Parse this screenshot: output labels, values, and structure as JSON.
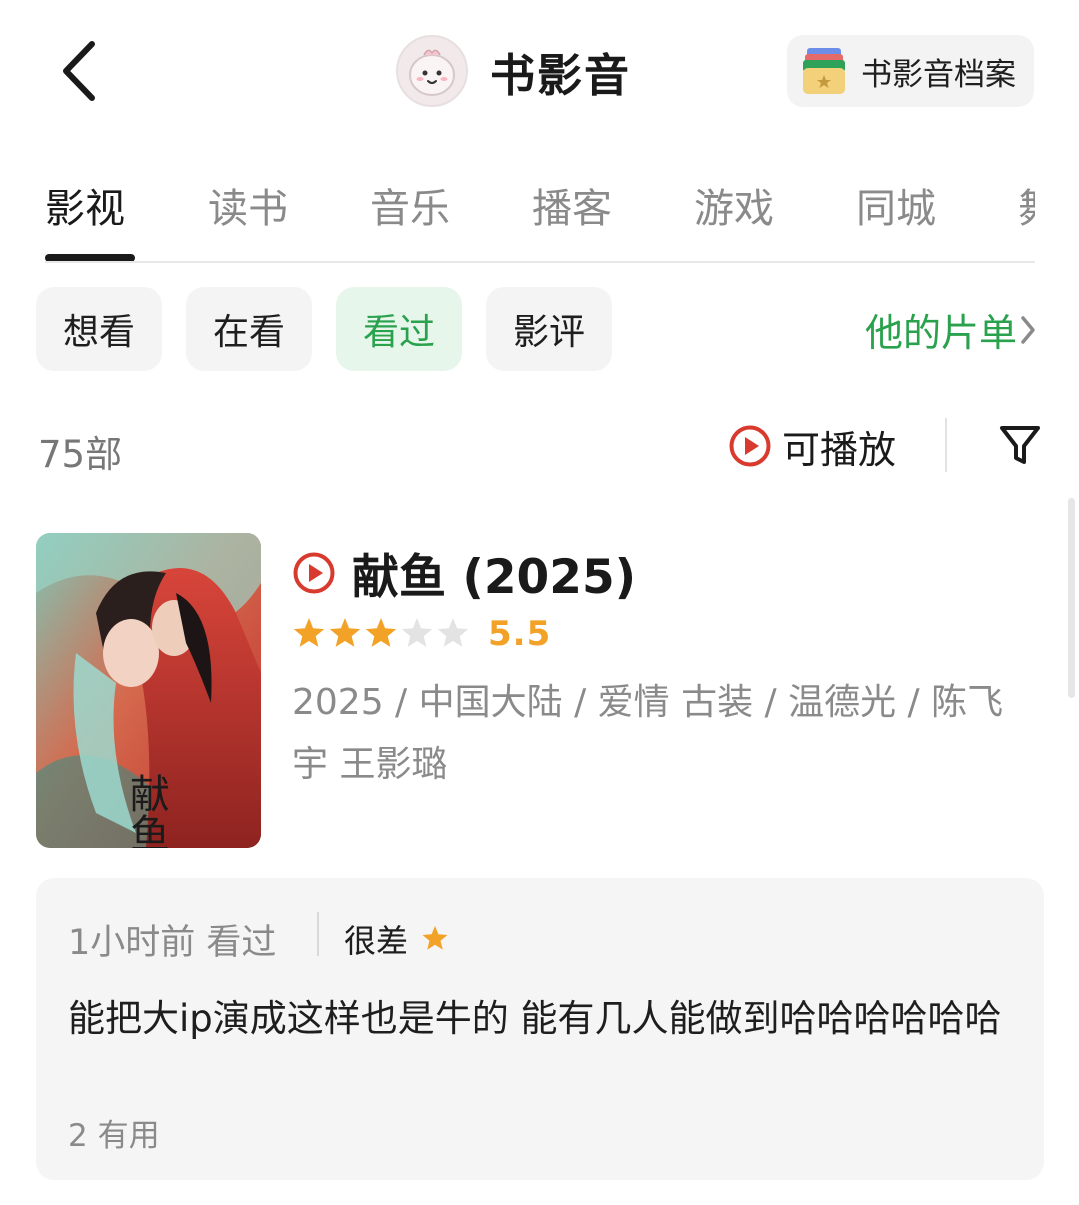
{
  "header": {
    "title": "书影音",
    "archive_label": "书影音档案"
  },
  "tabs": [
    {
      "label": "影视",
      "active": true
    },
    {
      "label": "读书"
    },
    {
      "label": "音乐"
    },
    {
      "label": "播客"
    },
    {
      "label": "游戏"
    },
    {
      "label": "同城"
    },
    {
      "label": "舞"
    }
  ],
  "filters": {
    "chips": [
      {
        "label": "想看"
      },
      {
        "label": "在看"
      },
      {
        "label": "看过",
        "active": true
      },
      {
        "label": "影评"
      }
    ],
    "playlist_link": "他的片单"
  },
  "list_header": {
    "count": "75部",
    "playable_label": "可播放"
  },
  "movie": {
    "title": "献鱼 (2025)",
    "rating_stars": 3,
    "rating_max": 5,
    "score": "5.5",
    "meta": "2025 / 中国大陆 / 爱情 古装 / 温德光 / 陈飞宇 王影璐",
    "poster_text": "献鱼"
  },
  "review": {
    "time": "1小时前 看过",
    "rating_label": "很差",
    "rating_stars": 1,
    "text": "能把大ip演成这样也是牛的 能有几人能做到哈哈哈哈哈哈",
    "useful": "2 有用"
  },
  "colors": {
    "accent_green": "#2aa14d",
    "chip_active_bg": "#e6f6ea",
    "star_orange": "#f2a227",
    "play_red": "#d83a2e"
  }
}
